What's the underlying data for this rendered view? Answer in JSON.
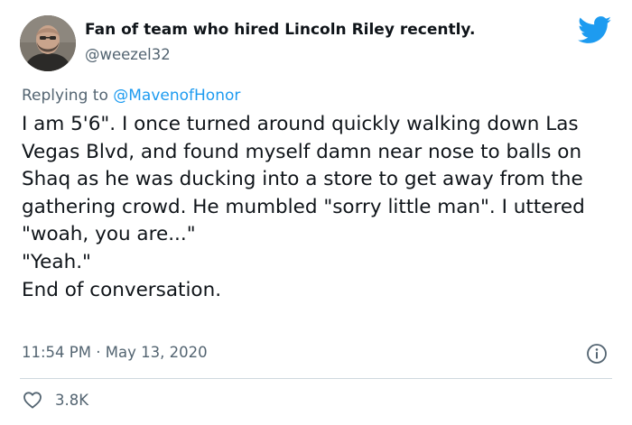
{
  "author": {
    "display_name": "Fan of team who hired Lincoln Riley recently.",
    "handle": "@weezel32",
    "avatar_icon": "profile-photo"
  },
  "reply": {
    "prefix": "Replying to ",
    "to_handle": "@MavenofHonor"
  },
  "tweet": {
    "text": "I am 5'6\". I once turned around quickly walking down Las Vegas Blvd, and found myself damn near nose to balls on Shaq as he was ducking into a store to get away from the gathering crowd. He mumbled \"sorry little man\". I uttered \"woah, you are...\"\n\"Yeah.\"\nEnd of conversation."
  },
  "meta": {
    "time": "11:54 PM",
    "separator": " · ",
    "date": "May 13, 2020",
    "info_icon": "info-icon"
  },
  "engagement": {
    "likes": "3.8K",
    "like_icon": "heart-icon"
  },
  "colors": {
    "brand": "#1d9bf0",
    "text": "#0f1419",
    "secondary_text": "#536471",
    "divider": "#cfd9de"
  }
}
